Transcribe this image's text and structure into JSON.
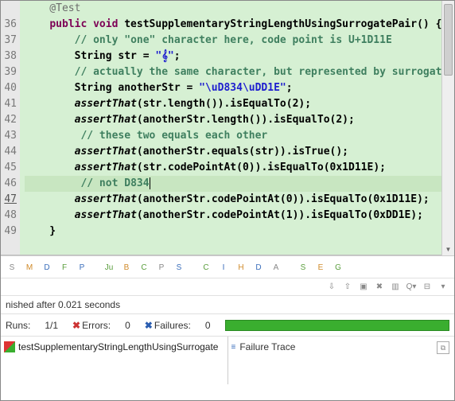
{
  "editor": {
    "lines": [
      {
        "num": "",
        "parts": [
          {
            "cls": "annot",
            "txt": "    @Test"
          }
        ]
      },
      {
        "num": "36",
        "parts": [
          {
            "cls": "plain",
            "txt": "    "
          },
          {
            "cls": "kw",
            "txt": "public void"
          },
          {
            "cls": "plain",
            "txt": " testSupplementaryStringLengthUsingSurrogatePair() {"
          }
        ]
      },
      {
        "num": "37",
        "parts": [
          {
            "cls": "plain",
            "txt": "        "
          },
          {
            "cls": "comment",
            "txt": "// only \"one\" character here, code point is U+1D11E"
          }
        ]
      },
      {
        "num": "38",
        "parts": [
          {
            "cls": "plain",
            "txt": "        String str = "
          },
          {
            "cls": "str",
            "txt": "\"𝄞\""
          },
          {
            "cls": "plain",
            "txt": ";"
          }
        ]
      },
      {
        "num": "39",
        "parts": [
          {
            "cls": "plain",
            "txt": "        "
          },
          {
            "cls": "comment",
            "txt": "// actually the same character, but represented by surrogate pair"
          }
        ]
      },
      {
        "num": "40",
        "parts": [
          {
            "cls": "plain",
            "txt": "        String anotherStr = "
          },
          {
            "cls": "str",
            "txt": "\"\\uD834\\uDD1E\""
          },
          {
            "cls": "plain",
            "txt": ";"
          }
        ]
      },
      {
        "num": "41",
        "parts": [
          {
            "cls": "plain",
            "txt": "        "
          },
          {
            "cls": "method-italic",
            "txt": "assertThat"
          },
          {
            "cls": "plain",
            "txt": "(str.length()).isEqualTo(2);"
          }
        ]
      },
      {
        "num": "42",
        "parts": [
          {
            "cls": "plain",
            "txt": "        "
          },
          {
            "cls": "method-italic",
            "txt": "assertThat"
          },
          {
            "cls": "plain",
            "txt": "(anotherStr.length()).isEqualTo(2);"
          }
        ]
      },
      {
        "num": "43",
        "parts": [
          {
            "cls": "plain",
            "txt": "         "
          },
          {
            "cls": "comment",
            "txt": "// these two equals each other"
          }
        ]
      },
      {
        "num": "44",
        "parts": [
          {
            "cls": "plain",
            "txt": "        "
          },
          {
            "cls": "method-italic",
            "txt": "assertThat"
          },
          {
            "cls": "plain",
            "txt": "(anotherStr.equals(str)).isTrue();"
          }
        ]
      },
      {
        "num": "45",
        "parts": [
          {
            "cls": "plain",
            "txt": "        "
          },
          {
            "cls": "method-italic",
            "txt": "assertThat"
          },
          {
            "cls": "plain",
            "txt": "(str.codePointAt(0)).isEqualTo(0x1D11E);"
          }
        ]
      },
      {
        "num": "46",
        "current": true,
        "parts": [
          {
            "cls": "plain",
            "txt": "         "
          },
          {
            "cls": "comment",
            "txt": "// not D834"
          }
        ]
      },
      {
        "num": "47",
        "underline": true,
        "parts": [
          {
            "cls": "plain",
            "txt": "        "
          },
          {
            "cls": "method-italic",
            "txt": "assertThat"
          },
          {
            "cls": "plain",
            "txt": "(anotherStr.codePointAt(0)).isEqualTo(0x1D11E);"
          }
        ]
      },
      {
        "num": "48",
        "parts": [
          {
            "cls": "plain",
            "txt": "        "
          },
          {
            "cls": "method-italic",
            "txt": "assertThat"
          },
          {
            "cls": "plain",
            "txt": "(anotherStr.codePointAt(1)).isEqualTo(0xDD1E);"
          }
        ]
      },
      {
        "num": "49",
        "parts": [
          {
            "cls": "plain",
            "txt": "    }"
          }
        ]
      }
    ]
  },
  "toolbar": {
    "icons_row1": [
      "S",
      "M",
      "D",
      "F",
      "P",
      "Ju",
      "B",
      "C",
      "P",
      "S",
      "C",
      "I",
      "H",
      "D",
      "A",
      "S",
      "E",
      "G"
    ],
    "icons_row2": [
      "⇩",
      "⇧",
      "▣",
      "✖",
      "▥",
      "Q▾",
      "⊟",
      "▾"
    ]
  },
  "status": {
    "text": "nished after 0.021 seconds"
  },
  "runs": {
    "runs_label": "Runs:",
    "runs_value": "1/1",
    "errors_label": "Errors:",
    "errors_value": "0",
    "failures_label": "Failures:",
    "failures_value": "0"
  },
  "results": {
    "test_name": "testSupplementaryStringLengthUsingSurrogate",
    "failure_trace_label": "Failure Trace"
  }
}
